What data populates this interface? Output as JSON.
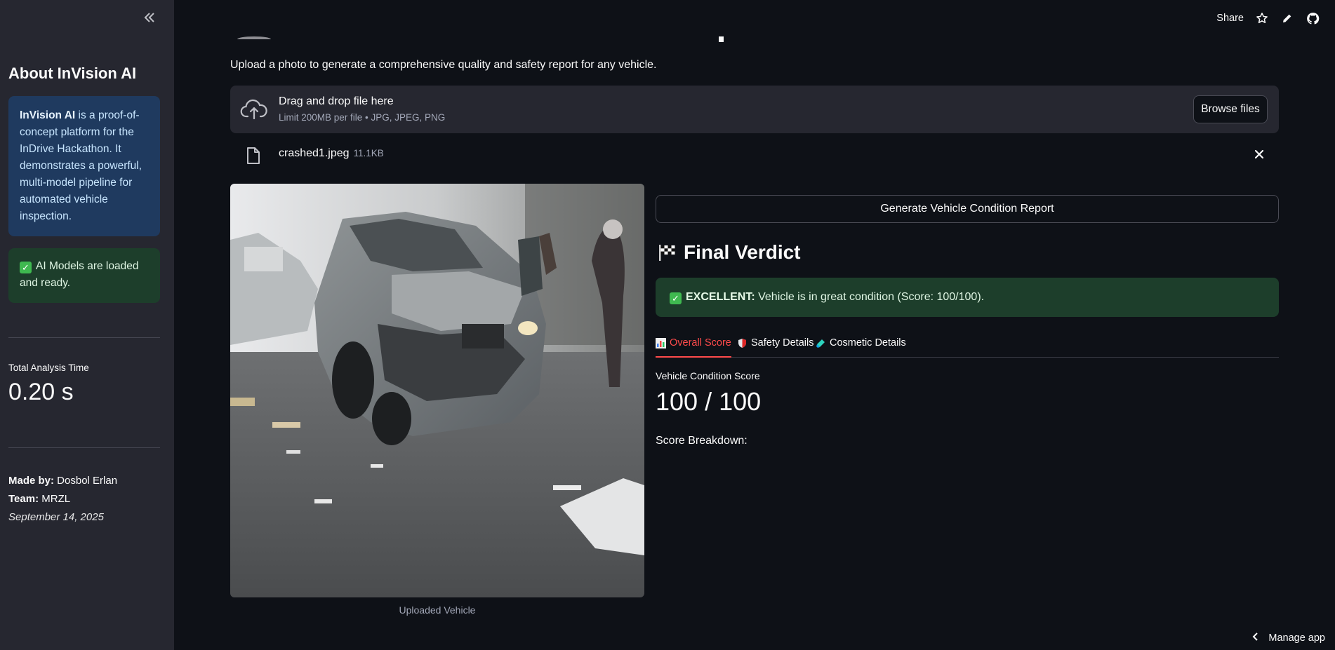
{
  "sidebar": {
    "collapse_icon": "double-chevron-left-icon",
    "title": "About InVision AI",
    "info": {
      "brand": "InVision AI",
      "text": " is a proof-of-concept platform for the InDrive Hackathon. It demonstrates a powerful, multi-model pipeline for automated vehicle inspection."
    },
    "status": {
      "icon": "check-icon",
      "text": "AI Models are loaded and ready."
    },
    "metric": {
      "label": "Total Analysis Time",
      "value": "0.20 s"
    },
    "credits": {
      "made_by_label": "Made by:",
      "made_by_value": " Dosbol Erlan",
      "team_label": "Team:",
      "team_value": " MRZL",
      "date": "September 14, 2025"
    }
  },
  "toolbar": {
    "share_label": "Share",
    "icons": [
      "star-icon",
      "edit-icon",
      "github-icon"
    ]
  },
  "main": {
    "subtitle": "Upload a photo to generate a comprehensive quality and safety report for any vehicle.",
    "uploader": {
      "title": "Drag and drop file here",
      "limits": "Limit 200MB per file • JPG, JPEG, PNG",
      "browse_label": "Browse files"
    },
    "file": {
      "name": "crashed1.jpeg",
      "size": "11.1KB"
    },
    "image_caption": "Uploaded Vehicle",
    "generate_label": "Generate Vehicle Condition Report",
    "verdict": {
      "title": "Final Verdict",
      "status_label": "EXCELLENT:",
      "status_text": " Vehicle is in great condition (Score: 100/100)."
    },
    "tabs": [
      {
        "label": "Overall Score",
        "icon": "bar-chart-icon",
        "active": true
      },
      {
        "label": "Safety Details",
        "icon": "shield-icon",
        "active": false
      },
      {
        "label": "Cosmetic Details",
        "icon": "paint-icon",
        "active": false
      }
    ],
    "score": {
      "label": "Vehicle Condition Score",
      "value": "100 / 100",
      "breakdown_label": "Score Breakdown:"
    }
  },
  "footer": {
    "manage_label": "Manage app"
  }
}
